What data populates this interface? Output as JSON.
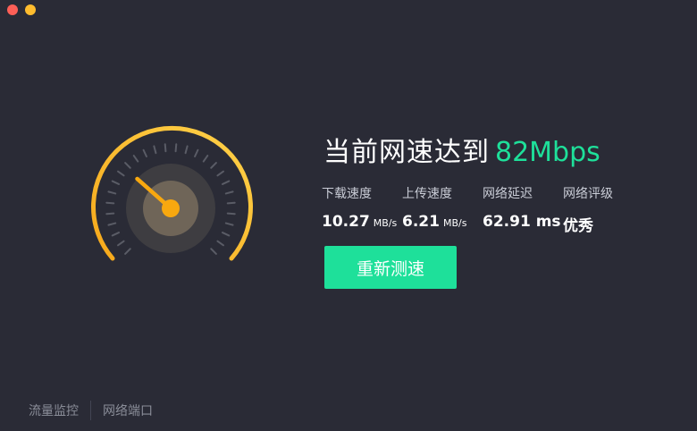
{
  "window": {
    "controls": [
      "close",
      "minimize"
    ]
  },
  "gauge": {
    "needle_fraction": 0.32,
    "colors": {
      "arc_start": "#f6b21a",
      "arc_end": "#ffd24a",
      "ticks": "#5a5c66",
      "hub": "#f8a80f"
    }
  },
  "result": {
    "title": "当前网速达到",
    "speed": "82Mbps"
  },
  "stats": [
    {
      "label": "下载速度",
      "value": "10.27",
      "unit": "MB/s"
    },
    {
      "label": "上传速度",
      "value": "6.21",
      "unit": "MB/s"
    },
    {
      "label": "网络延迟",
      "value": "62.91 ms",
      "unit": ""
    },
    {
      "label": "网络评级",
      "value": "优秀",
      "unit": ""
    }
  ],
  "actions": {
    "retest_label": "重新测速"
  },
  "footer": {
    "traffic_monitor": "流量监控",
    "network_ports": "网络端口"
  },
  "colors": {
    "accent": "#1ee09a",
    "background": "#2a2b36"
  }
}
